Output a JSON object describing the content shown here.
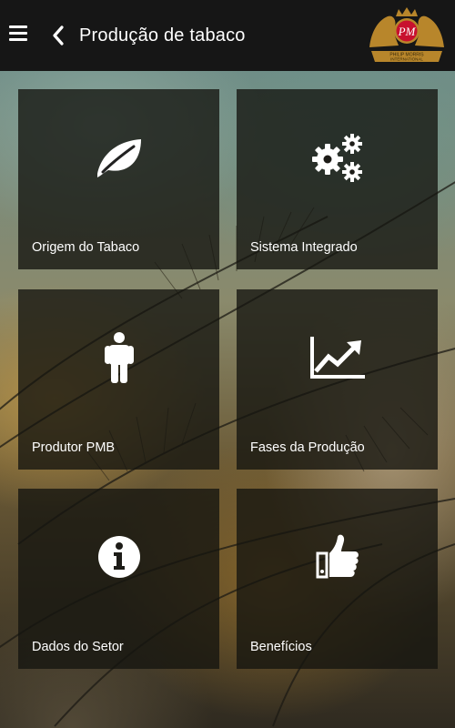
{
  "header": {
    "menu_icon": "hamburger-menu-icon",
    "back_icon": "chevron-left-icon",
    "title": "Produção de tabaco",
    "logo_text": [
      "PM",
      "PHILIP MORRIS",
      "INTERNATIONAL"
    ]
  },
  "tiles": [
    {
      "label": "Origem do Tabaco",
      "icon": "leaf-icon"
    },
    {
      "label": "Sistema Integrado",
      "icon": "gears-icon"
    },
    {
      "label": "Produtor PMB",
      "icon": "person-icon"
    },
    {
      "label": "Fases da Produção",
      "icon": "trending-chart-icon"
    },
    {
      "label": "Dados do Setor",
      "icon": "info-icon"
    },
    {
      "label": "Benefícios",
      "icon": "thumbs-up-icon"
    }
  ],
  "colors": {
    "appbar": "#161616",
    "tile_bg": "rgba(20,20,16,0.78)",
    "text": "#ffffff",
    "logo_red": "#c8102e",
    "logo_gold": "#b8862b"
  }
}
